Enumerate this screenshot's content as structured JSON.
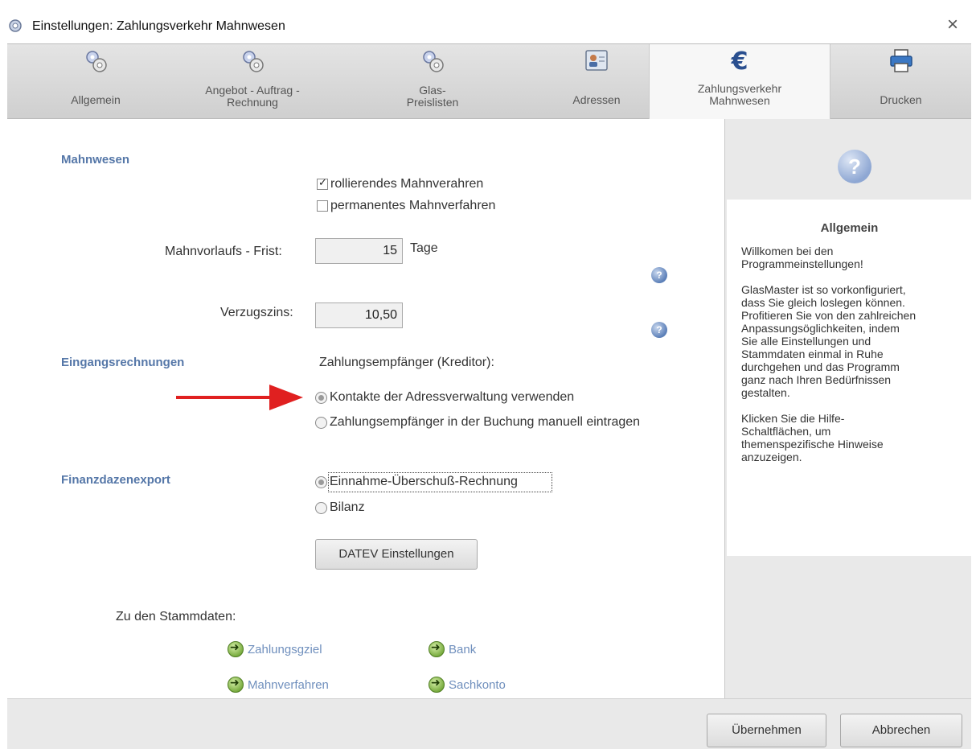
{
  "window": {
    "title": "Einstellungen: Zahlungsverkehr Mahnwesen",
    "close_symbol": "×"
  },
  "tabs": [
    {
      "label": "Allgemein",
      "icon": "gears-icon"
    },
    {
      "label": "Angebot - Auftrag - Rechnung",
      "icon": "gears-icon"
    },
    {
      "label": "Glas-Preislisten",
      "icon": "gears-icon"
    },
    {
      "label": "Adressen",
      "icon": "address-card-icon"
    },
    {
      "label": "Zahlungsverkehr Mahnwesen",
      "icon": "euro-icon",
      "active": true
    },
    {
      "label": "Drucken",
      "icon": "printer-icon"
    }
  ],
  "mahnwesen": {
    "heading": "Mahnwesen",
    "rollierend_label": "rollierendes Mahnverahren",
    "rollierend_checked": true,
    "permanent_label": "permanentes Mahnverfahren",
    "permanent_checked": false,
    "frist_label": "Mahnvorlaufs - Frist:",
    "frist_value": "15",
    "frist_unit": "Tage",
    "zins_label": "Verzugszins:",
    "zins_value": "10,50"
  },
  "eingang": {
    "heading": "Eingangsrechnungen",
    "empf_label": "Zahlungsempfänger (Kreditor):",
    "option1": "Kontakte der Adressverwaltung verwenden",
    "option2": "Zahlungsempfänger in der Buchung manuell eintragen",
    "selected": 1
  },
  "finanz": {
    "heading": "Finanzdazenexport",
    "option1": "Einnahme-Überschuß-Rechnung",
    "option2": "Bilanz",
    "selected": 1,
    "datev_button": "DATEV Einstellungen"
  },
  "stammdaten": {
    "label": "Zu den Stammdaten:",
    "links": [
      "Zahlungsgziel",
      "Bank",
      "Mahnverfahren",
      "Sachkonto"
    ]
  },
  "help": {
    "title": "Allgemein",
    "text": "Willkomen bei den\nProgrammeinstellungen!\n\nGlasMaster ist so vorkonfiguriert,\ndass Sie gleich loslegen können.\nProfitieren Sie von den zahlreichen\nAnpassungsöglichkeiten, indem\nSie alle Einstellungen und\nStammdaten einmal in Ruhe\ndurchgehen  und das Programm\nganz nach Ihren Bedürfnissen\ngestalten.\n\nKlicken Sie die Hilfe-\nSchaltflächen, um\nthemenspezifische Hinweise\nanzuzeigen."
  },
  "footer": {
    "apply": "Übernehmen",
    "cancel": "Abbrechen"
  },
  "colors": {
    "section_heading": "#5577a8",
    "link": "#6f8fbd",
    "arrow": "#e02020"
  }
}
